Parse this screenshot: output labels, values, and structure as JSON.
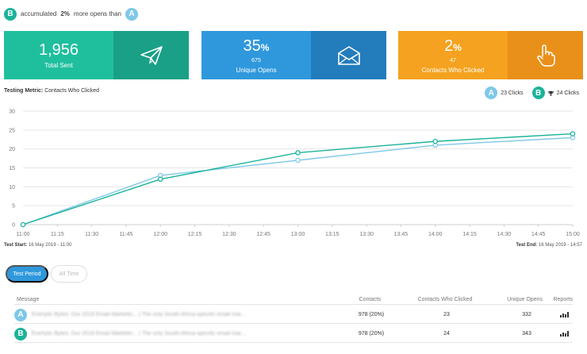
{
  "summary": {
    "prefix": "accumulated",
    "highlight": "2%",
    "suffix": "more opens than",
    "winner": "B",
    "loser": "A"
  },
  "cards": [
    {
      "value": "1,956",
      "unit": "",
      "sub": "",
      "label": "Total Sent",
      "icon": "paper-plane-icon"
    },
    {
      "value": "35",
      "unit": "%",
      "sub": "675",
      "label": "Unique Opens",
      "icon": "envelope-open-icon"
    },
    {
      "value": "2",
      "unit": "%",
      "sub": "47",
      "label": "Contacts Who Clicked",
      "icon": "pointer-hand-icon"
    }
  ],
  "metric": {
    "label": "Testing Metric:",
    "value": "Contacts Who Clicked"
  },
  "legend": {
    "a_badge": "A",
    "a_text": "23 Clicks",
    "b_badge": "B",
    "b_text": "24 Clicks"
  },
  "colors": {
    "a": "#7ec8e9",
    "b": "#1bb39a",
    "grid": "#e6e6e6"
  },
  "chart_data": {
    "type": "line",
    "x": [
      "11:00",
      "11:15",
      "11:30",
      "11:45",
      "12:00",
      "12:15",
      "12:30",
      "12:45",
      "13:00",
      "13:15",
      "13:30",
      "13:45",
      "14:00",
      "14:15",
      "14:30",
      "14:45",
      "15:00"
    ],
    "ylim": [
      0,
      30
    ],
    "yticks": [
      0,
      5,
      10,
      15,
      20,
      25,
      30
    ],
    "series": [
      {
        "name": "A",
        "color": "#7ec8e9",
        "points": [
          [
            "11:00",
            0
          ],
          [
            "12:00",
            13
          ],
          [
            "13:00",
            17
          ],
          [
            "14:00",
            21
          ],
          [
            "15:00",
            23
          ]
        ]
      },
      {
        "name": "B",
        "color": "#1bb39a",
        "points": [
          [
            "11:00",
            0
          ],
          [
            "12:00",
            12
          ],
          [
            "13:00",
            19
          ],
          [
            "14:00",
            22
          ],
          [
            "15:00",
            24
          ]
        ]
      }
    ]
  },
  "test_start": {
    "label": "Test Start:",
    "value": "16 May 2019 - 11:00"
  },
  "test_end": {
    "label": "Test End:",
    "value": "16 May 2019 - 14:57"
  },
  "buttons": {
    "test_period": "Test Period",
    "all_time": "All Time"
  },
  "table": {
    "headers": [
      "Message",
      "Contacts",
      "Contacts Who Clicked",
      "Unique Opens",
      "Reports"
    ],
    "rows": [
      {
        "badge": "A",
        "message": "Everlytic Bytes: Our 2018 Email Marketin... | The only South-Africa-specific email mar...",
        "contacts": "978 (20%)",
        "clicked": "23",
        "opens": "332"
      },
      {
        "badge": "B",
        "message": "Everlytic Bytes: Our 2018 Email Marketin... | The only South-Africa-specific email mar...",
        "contacts": "978 (20%)",
        "clicked": "24",
        "opens": "343"
      }
    ]
  }
}
